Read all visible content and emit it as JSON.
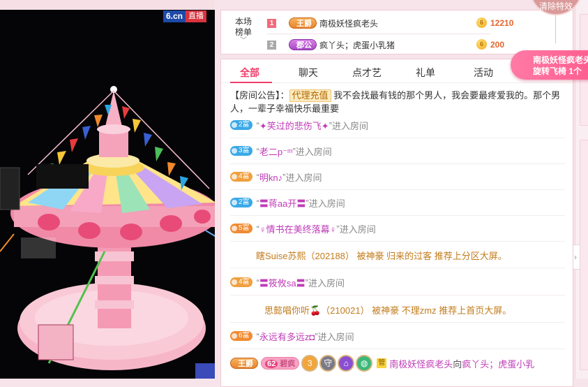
{
  "video": {
    "site_label": "6.cn",
    "live_label": "直播"
  },
  "ranking": {
    "title_line1": "本场",
    "title_line2": "榜单",
    "chevron": "﹀",
    "rows": [
      {
        "rank": "1",
        "badge": "王爵",
        "name": "南极妖怪疯老头",
        "score": "12210"
      },
      {
        "rank": "2",
        "badge": "郡公",
        "name": "疯丫头；虎蛋小乳猪",
        "score": "200"
      }
    ],
    "coin_symbol": "6"
  },
  "clear_effects_label": "清除特效",
  "gift_notice": {
    "line1": "南极妖怪疯老头",
    "line2": "旋转飞椅 1个"
  },
  "tabs": [
    "全部",
    "聊天",
    "点才艺",
    "礼单",
    "活动"
  ],
  "notice": {
    "prefix": "【房间公告】：",
    "agent": "代理充值",
    "text": " 我不会找最有钱的那个男人，我会要最疼爱我的。那个男人，一辈子幸福快乐最重要"
  },
  "messages": [
    {
      "level": "2富",
      "level_class": "fu2",
      "name": "✦笑过的悲伤飞✦",
      "suffix": "进入房间"
    },
    {
      "level": "3富",
      "level_class": "fu3",
      "name": "老二p⁻ᵐ",
      "suffix": "进入房间"
    },
    {
      "level": "4富",
      "level_class": "fu4",
      "name": "明kn♪",
      "suffix": "进入房间"
    },
    {
      "level": "2富",
      "level_class": "fu2",
      "name": "〓蒋aa开〓",
      "suffix": "进入房间"
    },
    {
      "level": "5富",
      "level_class": "fu5",
      "name": "♀情书在美终落幕♀",
      "suffix": "进入房间"
    }
  ],
  "sys_messages": [
    {
      "text": "瞎Suise苏熙（202188） 被神豪 归来的过客 推荐上分区大屏。"
    },
    {
      "level": "4富",
      "level_class": "fu4",
      "name": "〓筱攸sa〓",
      "suffix": "进入房间"
    },
    {
      "text": "思懿唱你听🍒（210021） 被神豪 不理zmz 推荐上首页大屏。"
    },
    {
      "level": "6富",
      "level_class": "fu5",
      "name": "永远有多远z◘",
      "suffix": "进入房间"
    }
  ],
  "last_line": {
    "badge": "王爵",
    "fans_level": "62",
    "fans_label": "碧疯",
    "num_icon": "3",
    "guard_icon": "守",
    "guan": "管",
    "sender": "南极妖怪疯老头",
    "to": " 向 ",
    "receiver": "疯丫头；虎蛋小乳"
  },
  "colors": {
    "accent": "#f23c6a",
    "page_bg": "#f6e4ea",
    "nick": "#c03bb7",
    "system": "#c27c1c"
  }
}
